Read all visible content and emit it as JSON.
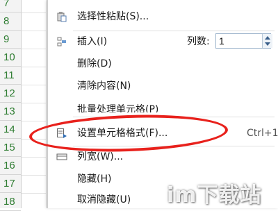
{
  "sheet": {
    "row_numbers": [
      "7",
      "8",
      "9",
      "10",
      "11",
      "12",
      "13",
      "14",
      "15",
      "16",
      "17",
      "18",
      "19"
    ]
  },
  "menu": {
    "paste_special": {
      "label": "选择性粘贴(S)...",
      "icon": "paste-special-icon"
    },
    "insert": {
      "label": "插入(I)",
      "icon": "insert-icon",
      "columns_label": "列数:",
      "columns_value": "1"
    },
    "delete": {
      "label": "删除(D)"
    },
    "clear_contents": {
      "label": "清除内容(N)"
    },
    "batch_cells": {
      "label": "批量处理单元格(P)"
    },
    "format_cells": {
      "label": "设置单元格格式(F)...",
      "shortcut": "Ctrl+1",
      "icon": "format-cells-icon"
    },
    "column_width": {
      "label": "列宽(W)...",
      "icon": "column-width-icon"
    },
    "hide": {
      "label": "隐藏(H)"
    },
    "unhide": {
      "label": "取消隐藏(U)"
    }
  },
  "highlight": {
    "color": "#e8211c"
  },
  "watermark": {
    "text": "im下载站"
  }
}
